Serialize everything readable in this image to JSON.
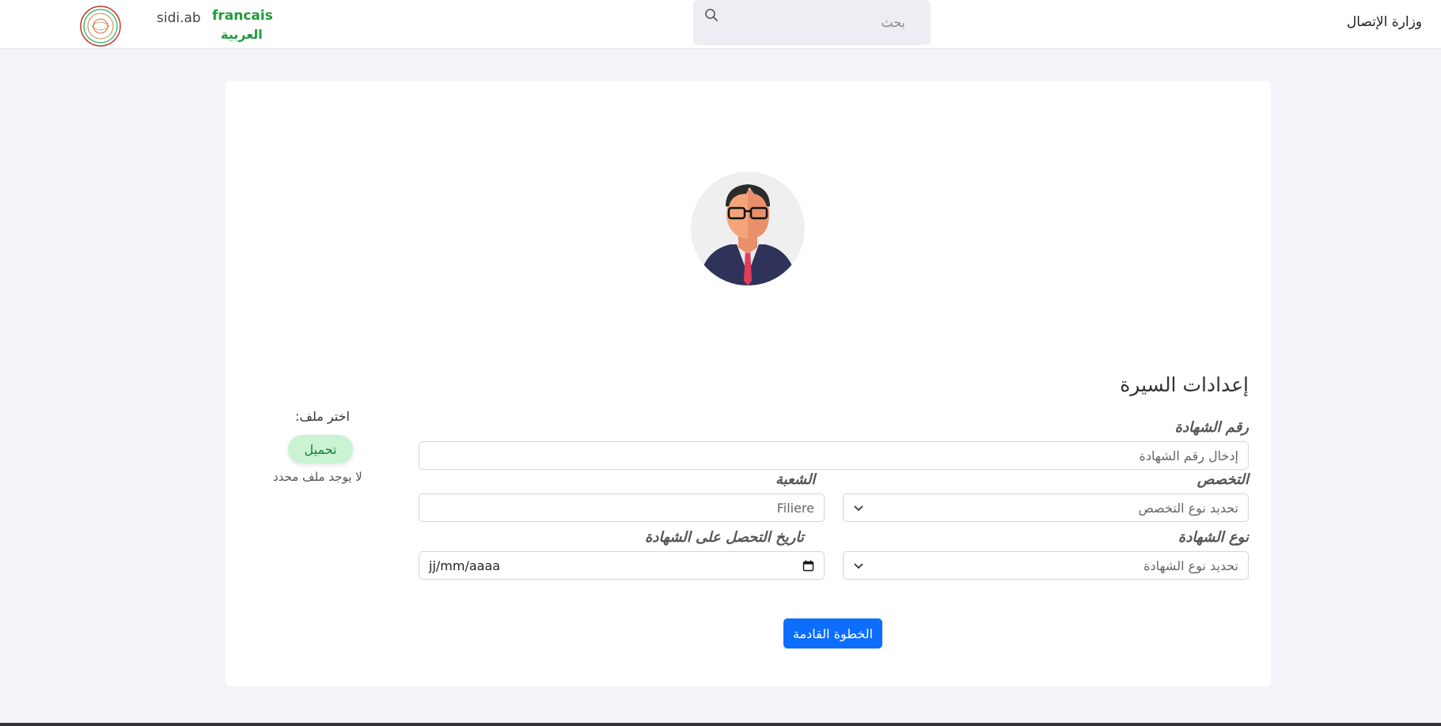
{
  "header": {
    "brand": "sidi.ab",
    "lang_fr": "francais",
    "lang_ar": "العربية",
    "search_placeholder": "بحث",
    "ministry": "وزارة الإتصال"
  },
  "form": {
    "title": "إعدادات السيرة",
    "certificate_number_label": "رقم الشهادة",
    "certificate_number_placeholder": "إدخال رقم الشهادة",
    "specialty_label": "التخصص",
    "specialty_value": "تحديد نوع التخصص",
    "branch_label": "الشعبة",
    "branch_placeholder": "Filiere",
    "certificate_type_label": "نوع الشهادة",
    "certificate_type_value": "تحديد نوع الشهادة",
    "obtain_date_label": "تاريخ التحصل على الشهادة",
    "date_placeholder": "jj/mm/aaaa",
    "next_button": "الخطوة القادمة"
  },
  "file_upload": {
    "label": "اختر ملف:",
    "button": "تحميل",
    "status": "لا يوجد ملف محدد"
  },
  "colors": {
    "accent": "#0d6efd",
    "lang_green": "#1e9b3c",
    "upload_bg": "#c9f3d3",
    "page_bg": "#f5f3fa"
  }
}
